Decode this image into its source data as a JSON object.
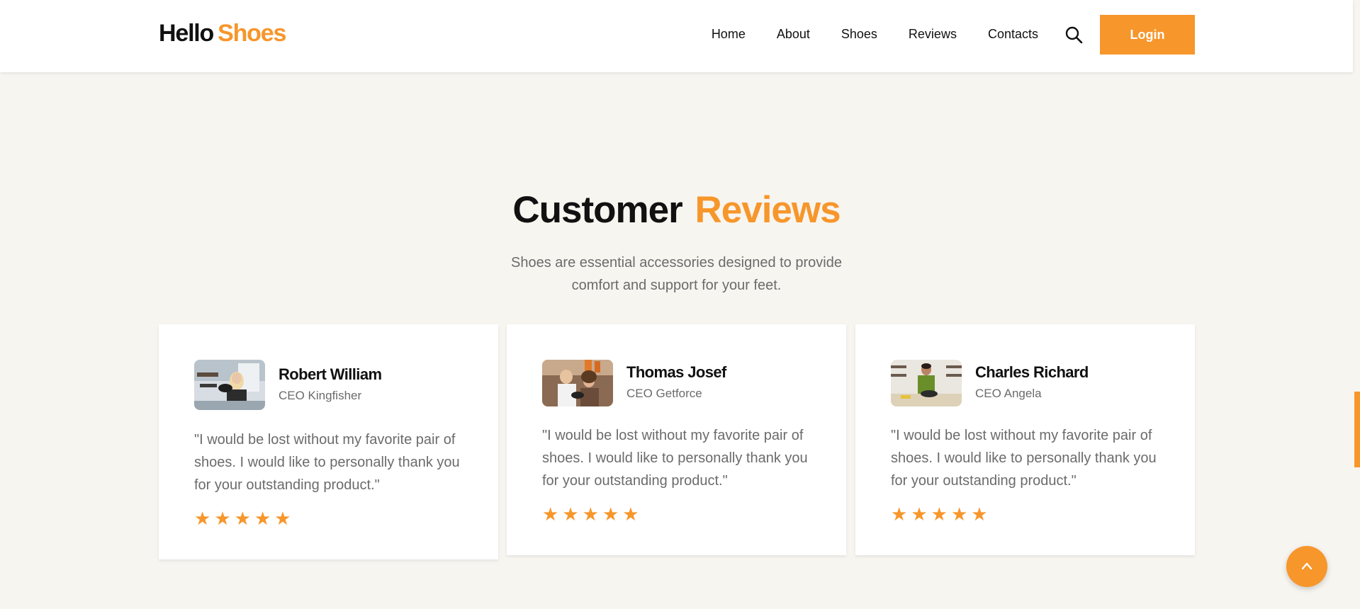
{
  "header": {
    "logo_primary": "Hello",
    "logo_accent": "Shoes",
    "nav": [
      "Home",
      "About",
      "Shoes",
      "Reviews",
      "Contacts"
    ],
    "search_icon": "search-icon",
    "login_label": "Login"
  },
  "section": {
    "title_primary": "Customer",
    "title_accent": "Reviews",
    "subtitle_line1": "Shoes are essential accessories designed to provide",
    "subtitle_line2": "comfort and support for your feet."
  },
  "reviews": [
    {
      "name": "Robert William",
      "role": "CEO Kingfisher",
      "text": "\"I would be lost without my favorite pair of shoes. I would like to personally thank you for your outstanding product.\"",
      "rating": 5
    },
    {
      "name": "Thomas Josef",
      "role": "CEO Getforce",
      "text": "\"I would be lost without my favorite pair of shoes. I would like to personally thank you for your outstanding product.\"",
      "rating": 5
    },
    {
      "name": "Charles Richard",
      "role": "CEO Angela",
      "text": "\"I would be lost without my favorite pair of shoes. I would like to personally thank you for your outstanding product.\"",
      "rating": 5
    }
  ],
  "scroll_top_icon": "chevron-up-icon",
  "colors": {
    "accent": "#f7962b",
    "text_dark": "#111111",
    "text_muted": "#6b6b6b",
    "page_background": "#f7f5f0",
    "card_background": "#ffffff"
  }
}
